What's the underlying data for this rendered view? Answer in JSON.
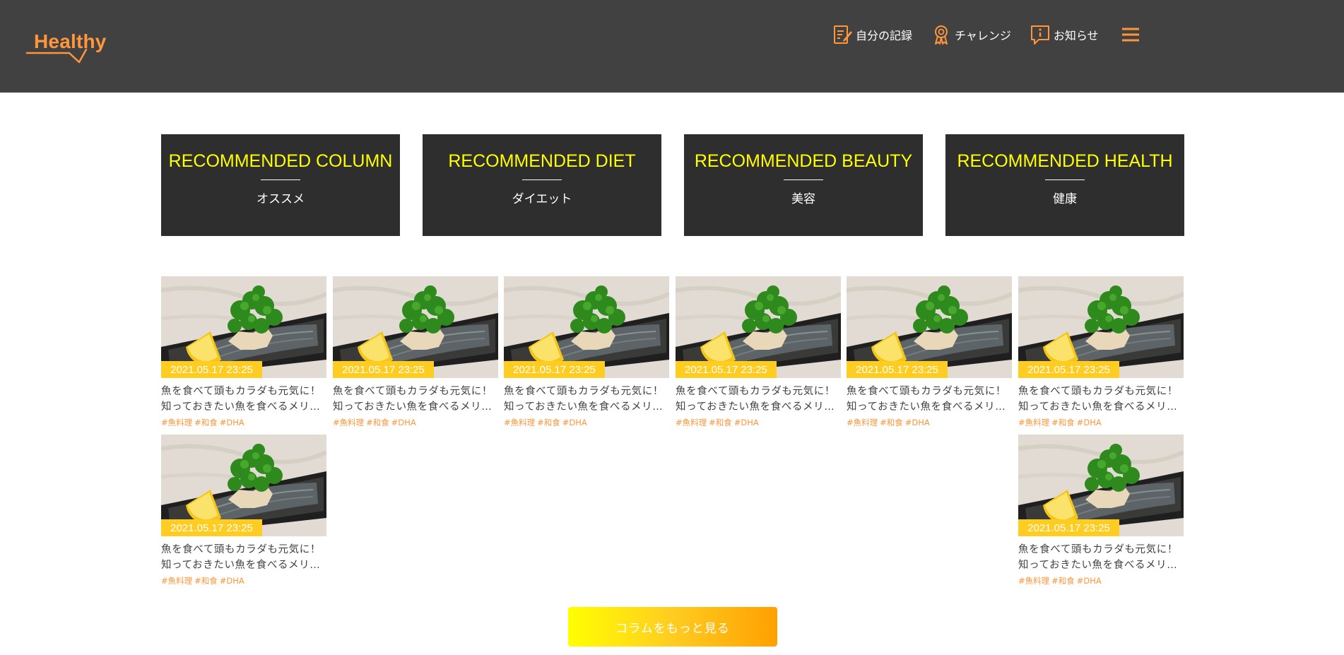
{
  "header": {
    "logo_text": "Healthy",
    "nav": [
      {
        "label": "自分の記録",
        "icon": "memo-icon"
      },
      {
        "label": "チャレンジ",
        "icon": "medal-icon"
      },
      {
        "label": "お知らせ",
        "icon": "info-icon"
      }
    ],
    "menu_icon": "hamburger-menu-icon"
  },
  "colors": {
    "header_bg": "#414141",
    "accent_orange": "#FF963C",
    "tile_bg": "#2E2E2E",
    "tile_title": "#FFFF00",
    "badge_yellow": "#FFCC21"
  },
  "categories": [
    {
      "title": "RECOMMENDED COLUMN",
      "subtitle": "オススメ"
    },
    {
      "title": "RECOMMENDED DIET",
      "subtitle": "ダイエット"
    },
    {
      "title": "RECOMMENDED BEAUTY",
      "subtitle": "美容"
    },
    {
      "title": "RECOMMENDED HEALTH",
      "subtitle": "健康"
    }
  ],
  "columns": [
    {
      "date": "2021.05.17 23:25",
      "title": "魚を食べて頭もカラダも元気に！知っておきたい魚を食べるメリ…",
      "tags": [
        "#魚料理",
        "#和食",
        "#DHA"
      ]
    },
    {
      "date": "2021.05.17 23:25",
      "title": "魚を食べて頭もカラダも元気に！知っておきたい魚を食べるメリ…",
      "tags": [
        "#魚料理",
        "#和食",
        "#DHA"
      ]
    },
    {
      "date": "2021.05.17 23:25",
      "title": "魚を食べて頭もカラダも元気に！知っておきたい魚を食べるメリ…",
      "tags": [
        "#魚料理",
        "#和食",
        "#DHA"
      ]
    },
    {
      "date": "2021.05.17 23:25",
      "title": "魚を食べて頭もカラダも元気に！知っておきたい魚を食べるメリ…",
      "tags": [
        "#魚料理",
        "#和食",
        "#DHA"
      ]
    },
    {
      "date": "2021.05.17 23:25",
      "title": "魚を食べて頭もカラダも元気に！知っておきたい魚を食べるメリ…",
      "tags": [
        "#魚料理",
        "#和食",
        "#DHA"
      ]
    },
    {
      "date": "2021.05.17 23:25",
      "title": "魚を食べて頭もカラダも元気に！知っておきたい魚を食べるメリ…",
      "tags": [
        "#魚料理",
        "#和食",
        "#DHA"
      ]
    },
    {
      "date": "2021.05.17 23:25",
      "title": "魚を食べて頭もカラダも元気に！知っておきたい魚を食べるメリ…",
      "tags": [
        "#魚料理",
        "#和食",
        "#DHA"
      ]
    },
    {
      "date": "2021.05.17 23:25",
      "title": "魚を食べて頭もカラダも元気に！知っておきたい魚を食べるメリ…",
      "tags": [
        "#魚料理",
        "#和食",
        "#DHA"
      ]
    }
  ],
  "more_button": "コラムをもっと見る"
}
